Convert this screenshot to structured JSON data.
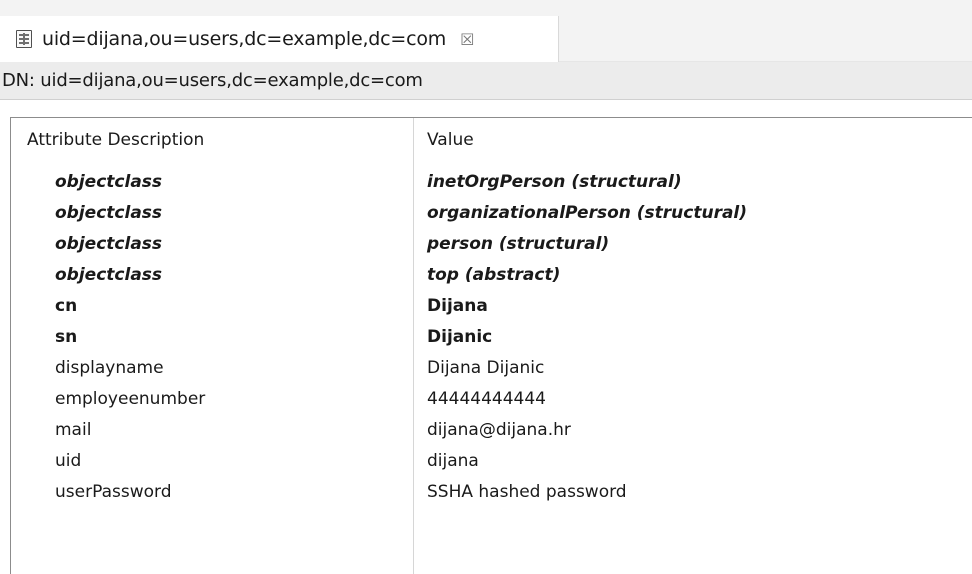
{
  "tab": {
    "title": "uid=dijana,ou=users,dc=example,dc=com",
    "close_glyph": "☒"
  },
  "dn_bar": {
    "text": "DN: uid=dijana,ou=users,dc=example,dc=com"
  },
  "table": {
    "headers": {
      "attribute": "Attribute Description",
      "value": "Value"
    },
    "rows": [
      {
        "attribute": "objectclass",
        "value": "inetOrgPerson (structural)"
      },
      {
        "attribute": "objectclass",
        "value": "organizationalPerson (structural)"
      },
      {
        "attribute": "objectclass",
        "value": "person (structural)"
      },
      {
        "attribute": "objectclass",
        "value": "top (abstract)"
      },
      {
        "attribute": "cn",
        "value": "Dijana"
      },
      {
        "attribute": "sn",
        "value": "Dijanic"
      },
      {
        "attribute": "displayname",
        "value": "Dijana Dijanic"
      },
      {
        "attribute": "employeenumber",
        "value": "44444444444"
      },
      {
        "attribute": "mail",
        "value": "dijana@dijana.hr"
      },
      {
        "attribute": "uid",
        "value": "dijana"
      },
      {
        "attribute": "userPassword",
        "value": "SSHA hashed password"
      }
    ]
  }
}
